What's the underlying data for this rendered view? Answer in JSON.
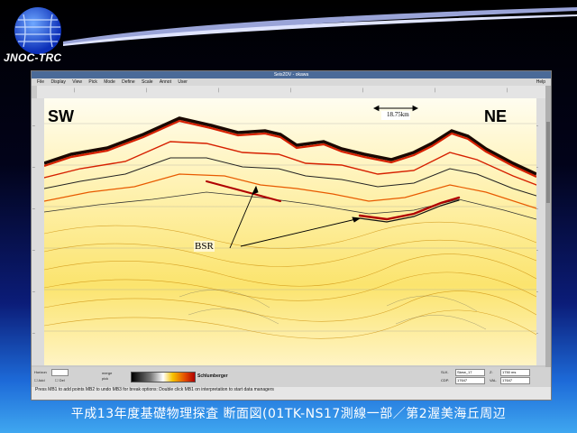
{
  "brand": {
    "name": "JNOC-TRC"
  },
  "window": {
    "title": "Seis2DV - okawa",
    "menu": [
      "File",
      "Display",
      "View",
      "Pick",
      "Mode",
      "Define",
      "Scale",
      "Annot",
      "User"
    ],
    "help": "Help"
  },
  "section": {
    "left_label": "SW",
    "right_label": "NE",
    "scale_label": "18.75km",
    "feature_label": "BSR",
    "colors": {
      "positive": "#d62000",
      "mid": "#f3c400",
      "negative": "#111111",
      "background": "#fff6c8"
    }
  },
  "bottom": {
    "horizon_label": "Horizon",
    "checkbox_a": "Add",
    "checkbox_b": "Del",
    "merge_label": "merge",
    "pick_label": "pick",
    "vendor": "Schlumberger",
    "fields": [
      {
        "label": "SLK.",
        "value": "Skew_17"
      },
      {
        "label": "Z:",
        "value": "1750 ms"
      },
      {
        "label": "CDP.",
        "value": "17647"
      },
      {
        "label": "VAL.",
        "value": "17647"
      }
    ]
  },
  "status": {
    "text": "Press MB1 to add points MB2 to undo MB3 for break options: Double click MB1 on interpretation to start data managers"
  },
  "caption": "平成13年度基礎物理探査 断面図(01TK-NS17測線一部／第2渥美海丘周辺"
}
